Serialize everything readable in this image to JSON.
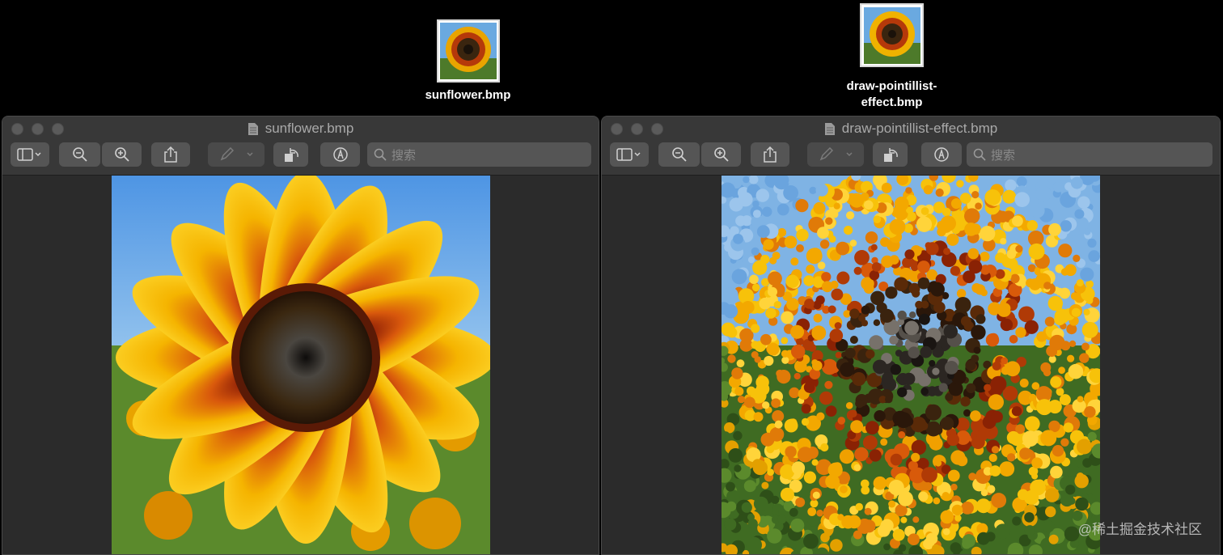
{
  "desktop": {
    "icons": [
      {
        "label": "sunflower.bmp"
      },
      {
        "label_line1": "draw-pointillist-",
        "label_line2": "effect.bmp"
      }
    ]
  },
  "windows": [
    {
      "title": "sunflower.bmp",
      "search_placeholder": "搜索"
    },
    {
      "title": "draw-pointillist-effect.bmp",
      "search_placeholder": "搜索"
    }
  ],
  "watermark": "@稀土掘金技术社区",
  "colors": {
    "window_bg": "#2b2b2b",
    "titlebar": "#383838",
    "sky": "#5aa3e6",
    "petal": "#f4b100",
    "petal_dark": "#b83a08",
    "center": "#2d1d0c"
  }
}
